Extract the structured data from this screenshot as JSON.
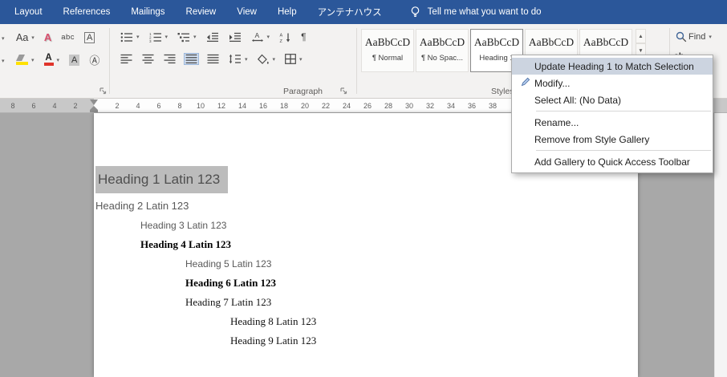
{
  "colors": {
    "titlebar_blue": "#2b579a",
    "ribbon_bg": "#f3f2f1",
    "canvas_gray": "#a8a8a8",
    "selection_gray": "#bcbcbc",
    "menu_highlight": "#ccd4e0",
    "heading_gray": "#595959",
    "highlight_yellow": "#ffe100",
    "font_color_red": "#e0342b"
  },
  "tabbar": {
    "tabs": [
      "Layout",
      "References",
      "Mailings",
      "Review",
      "View",
      "Help",
      "アンテナハウス"
    ],
    "tell_me": "Tell me what you want to do"
  },
  "ribbon": {
    "icons": {
      "change_case": "Aa",
      "text_effects": "A",
      "phonetic_guide": "abc",
      "character_border": "A",
      "font_color": "A",
      "character_shading": "A",
      "enclose_characters": "Ⓐ",
      "paragraph_mark": "¶",
      "replace": "ab",
      "gallery_up": "▲",
      "gallery_down": "▼",
      "gallery_more": "▼"
    },
    "group_labels": {
      "paragraph": "Paragraph",
      "styles": "Styles"
    },
    "find_label": "Find",
    "style_gallery": [
      {
        "preview": "AaBbCcD",
        "label": "¶ Normal",
        "selected": false
      },
      {
        "preview": "AaBbCcD",
        "label": "¶ No Spac...",
        "selected": false
      },
      {
        "preview": "AaBbCcD",
        "label": "Heading 1",
        "selected": true
      },
      {
        "preview": "AaBbCcD",
        "label": "",
        "selected": false
      },
      {
        "preview": "AaBbCcD",
        "label": "",
        "selected": false
      }
    ]
  },
  "context_menu": {
    "items": [
      {
        "type": "item",
        "label": "Update Heading 1 to Match Selection",
        "highlighted": true,
        "icon": ""
      },
      {
        "type": "item",
        "label": "Modify...",
        "highlighted": false,
        "icon": "modify-style-icon"
      },
      {
        "type": "item",
        "label": "Select All: (No Data)",
        "highlighted": false,
        "icon": ""
      },
      {
        "type": "separator"
      },
      {
        "type": "item",
        "label": "Rename...",
        "highlighted": false,
        "icon": ""
      },
      {
        "type": "item",
        "label": "Remove from Style Gallery",
        "highlighted": false,
        "icon": ""
      },
      {
        "type": "separator"
      },
      {
        "type": "item",
        "label": "Add Gallery to Quick Access Toolbar",
        "highlighted": false,
        "icon": ""
      }
    ]
  },
  "ruler": {
    "margin_numbers": [
      "8",
      "6",
      "4",
      "2"
    ],
    "page_numbers": [
      "2",
      "4",
      "6",
      "8",
      "10",
      "12",
      "14",
      "16",
      "18",
      "20",
      "22",
      "24",
      "26",
      "28",
      "30",
      "32",
      "34",
      "36",
      "38"
    ]
  },
  "document": {
    "headings": [
      {
        "text": "Heading 1 Latin 123",
        "level": 1,
        "selected": true
      },
      {
        "text": "Heading 2 Latin 123",
        "level": 2,
        "selected": false
      },
      {
        "text": "Heading 3 Latin 123",
        "level": 3,
        "selected": false
      },
      {
        "text": "Heading 4 Latin 123",
        "level": 4,
        "selected": false
      },
      {
        "text": "Heading 5 Latin 123",
        "level": 5,
        "selected": false
      },
      {
        "text": "Heading 6 Latin 123",
        "level": 6,
        "selected": false
      },
      {
        "text": "Heading 7 Latin 123",
        "level": 7,
        "selected": false
      },
      {
        "text": "Heading 8 Latin 123",
        "level": 8,
        "selected": false
      },
      {
        "text": "Heading 9 Latin 123",
        "level": 9,
        "selected": false
      }
    ]
  }
}
